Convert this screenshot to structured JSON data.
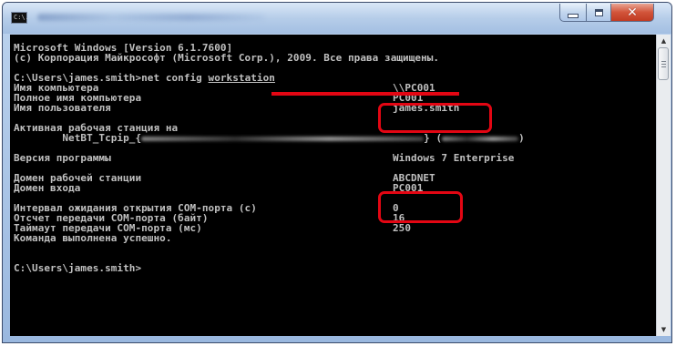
{
  "window": {
    "title_icon_text": "C:\\."
  },
  "controls": {
    "close_glyph": "✕"
  },
  "scrollbar": {
    "up_glyph": "▲",
    "down_glyph": "▼"
  },
  "console": {
    "header_line1": "Microsoft Windows [Version 6.1.7600]",
    "header_line2": "(c) Корпорация Майкрософт (Microsoft Corp.), 2009. Все права защищены.",
    "prompt1_prefix": "C:\\Users\\james.smith>net config ",
    "prompt1_keyword": "workstation",
    "computer_name_label": "Имя компьютера",
    "computer_name_value": "\\\\PC001",
    "full_computer_name_label": "Полное имя компьютера",
    "full_computer_name_value": "PC001",
    "username_label": "Имя пользователя",
    "username_value": "james.smith",
    "active_station_label": "Активная рабочая станция на",
    "netbt_prefix": "        NetBT_Tcpip_{",
    "netbt_mid": "} (",
    "netbt_end": ")",
    "version_label": "Версия программы",
    "version_value": "Windows 7 Enterprise",
    "workstation_domain_label": "Домен рабочей станции",
    "workstation_domain_value": "ABCDNET",
    "logon_domain_label": "Домен входа",
    "logon_domain_value": "PC001",
    "com_timeout_label": "Интервал ожидания открытия COM-порта (c)",
    "com_timeout_value": "0",
    "com_bytes_label": "Отсчет передачи COM-порта (байт)",
    "com_bytes_value": "16",
    "com_ms_label": "Таймаут передачи COM-порта (мс)",
    "com_ms_value": "250",
    "success_line": "Команда выполнена успешно.",
    "final_prompt": "C:\\Users\\james.smith>"
  },
  "colors": {
    "console_text": "#c0c0c0",
    "console_bg": "#000000",
    "highlight_red": "#e30613"
  }
}
